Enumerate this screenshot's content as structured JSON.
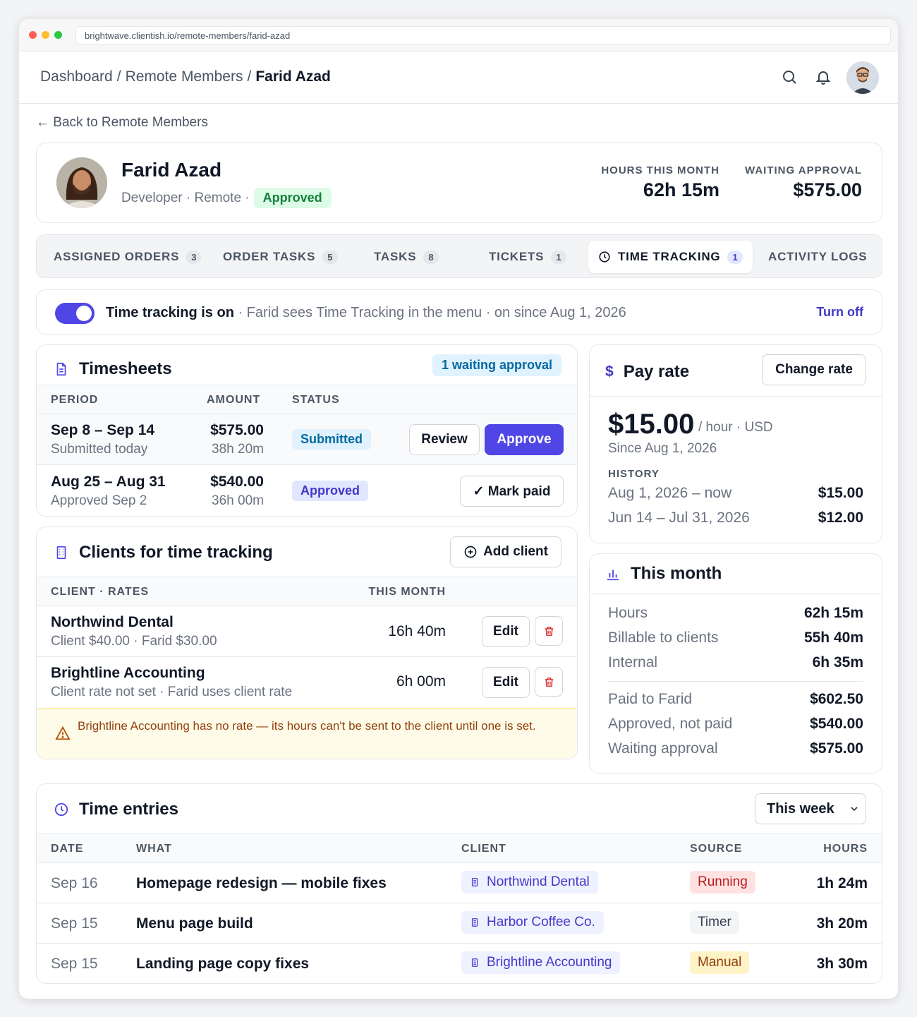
{
  "browser": {
    "url": "brightwave.clientish.io/remote-members/farid-azad"
  },
  "breadcrumb": {
    "items": [
      "Dashboard",
      "Remote Members"
    ],
    "current": "Farid Azad",
    "separator": "/"
  },
  "back_link": "← Back to Remote Members",
  "profile": {
    "name": "Farid Azad",
    "role_line": "Developer · Remote ·",
    "status": "Approved",
    "stats": [
      {
        "label": "HOURS THIS MONTH",
        "value": "62h 15m"
      },
      {
        "label": "WAITING APPROVAL",
        "value": "$575.00"
      }
    ]
  },
  "tabs": [
    {
      "label": "ASSIGNED ORDERS",
      "count": "3"
    },
    {
      "label": "ORDER TASKS",
      "count": "5"
    },
    {
      "label": "TASKS",
      "count": "8"
    },
    {
      "label": "TICKETS",
      "count": "1"
    },
    {
      "label": "TIME TRACKING",
      "count": "1",
      "active": true
    },
    {
      "label": "ACTIVITY LOGS"
    }
  ],
  "tracking": {
    "title": "Time tracking is on",
    "detail": " · Farid sees Time Tracking in the menu · on since Aug 1, 2026",
    "action": "Turn off"
  },
  "timesheets": {
    "title": "Timesheets",
    "badge": "1 waiting approval",
    "columns": [
      "PERIOD",
      "AMOUNT",
      "STATUS"
    ],
    "rows": [
      {
        "period": "Sep 8 – Sep 14",
        "sub": "Submitted today",
        "amount": "$575.00",
        "hours": "38h 20m",
        "status": "Submitted",
        "actions": [
          "Review",
          "Approve"
        ]
      },
      {
        "period": "Aug 25 – Aug 31",
        "sub": "Approved Sep 2",
        "amount": "$540.00",
        "hours": "36h 00m",
        "status": "Approved",
        "actions": [
          "✓ Mark paid"
        ]
      }
    ]
  },
  "clients": {
    "title": "Clients for time tracking",
    "add_label": "Add client",
    "columns": [
      "CLIENT · RATES",
      "THIS MONTH"
    ],
    "rows": [
      {
        "name": "Northwind Dental",
        "rates": "Client $40.00 · Farid $30.00",
        "month": "16h 40m",
        "edit": "Edit"
      },
      {
        "name": "Brightline Accounting",
        "rates": "Client rate not set · Farid uses client rate",
        "month": "6h 00m",
        "edit": "Edit"
      }
    ],
    "warning": "Brightline Accounting has no rate — its hours can't be sent to the client until one is set."
  },
  "pay_rate": {
    "title": "Pay rate",
    "change_label": "Change rate",
    "amount": "$15.00",
    "unit": "/ hour · USD",
    "since": "Since Aug 1, 2026",
    "history_label": "HISTORY",
    "history": [
      {
        "range": "Aug 1, 2026 – now",
        "rate": "$15.00"
      },
      {
        "range": "Jun 14 – Jul 31, 2026",
        "rate": "$12.00"
      }
    ]
  },
  "this_month": {
    "title": "This month",
    "hours": [
      {
        "label": "Hours",
        "value": "62h 15m"
      },
      {
        "label": "Billable to clients",
        "value": "55h 40m"
      },
      {
        "label": "Internal",
        "value": "6h 35m"
      }
    ],
    "money": [
      {
        "label": "Paid to Farid",
        "value": "$602.50"
      },
      {
        "label": "Approved, not paid",
        "value": "$540.00"
      },
      {
        "label": "Waiting approval",
        "value": "$575.00"
      }
    ]
  },
  "entries": {
    "title": "Time entries",
    "filter": "This week",
    "columns": [
      "DATE",
      "WHAT",
      "CLIENT",
      "SOURCE",
      "HOURS"
    ],
    "rows": [
      {
        "date": "Sep 16",
        "what": "Homepage redesign — mobile fixes",
        "client": "Northwind Dental",
        "source": "Running",
        "hours": "1h 24m"
      },
      {
        "date": "Sep 15",
        "what": "Menu page build",
        "client": "Harbor Coffee Co.",
        "source": "Timer",
        "hours": "3h 20m"
      },
      {
        "date": "Sep 15",
        "what": "Landing page copy fixes",
        "client": "Brightline Accounting",
        "source": "Manual",
        "hours": "3h 30m"
      }
    ]
  },
  "colors": {
    "accent": "#4f46e5",
    "success": "#15803d",
    "danger": "#dc2626",
    "warning": "#92400e"
  }
}
